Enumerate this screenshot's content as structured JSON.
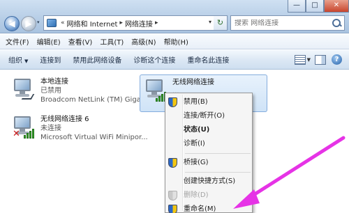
{
  "address": {
    "prefix": "«",
    "crumbs": [
      "网络和 Internet",
      "网络连接"
    ],
    "separator": "▸",
    "dropdown": "▾",
    "refresh": "↻"
  },
  "search": {
    "placeholder": "搜索 网络连接"
  },
  "window_controls": {
    "minimize": "—",
    "maximize": "□",
    "close": "✕"
  },
  "nav": {
    "back": "◀",
    "forward": "▶",
    "history": "▾"
  },
  "menubar": [
    "文件(F)",
    "编辑(E)",
    "查看(V)",
    "工具(T)",
    "高级(N)",
    "帮助(H)"
  ],
  "toolbar": {
    "organize": "组织",
    "caret": "▼",
    "connect_to": "连接到",
    "disable": "禁用此网络设备",
    "diagnose": "诊断这个连接",
    "rename": "重命名此连接",
    "help": "?"
  },
  "connections": [
    {
      "name": "本地连接",
      "status": "已禁用",
      "adapter": "Broadcom NetLink (TM) Giga..."
    },
    {
      "name": "无线网络连接",
      "status": "...",
      "adapter": ""
    },
    {
      "name": "无线网络连接 6",
      "status": "未连接",
      "adapter": "Microsoft Virtual WiFi Minipor..."
    }
  ],
  "context_menu": {
    "disable": "禁用(B)",
    "connect": "连接/断开(O)",
    "status": "状态(U)",
    "diagnose": "诊断(I)",
    "bridge": "桥接(G)",
    "shortcut": "创建快捷方式(S)",
    "delete": "删除(D)",
    "rename": "重命名(M)"
  },
  "colors": {
    "annotation_arrow": "#e633e6",
    "selection": "#cfe3f7",
    "accent": "#2b68c6"
  }
}
